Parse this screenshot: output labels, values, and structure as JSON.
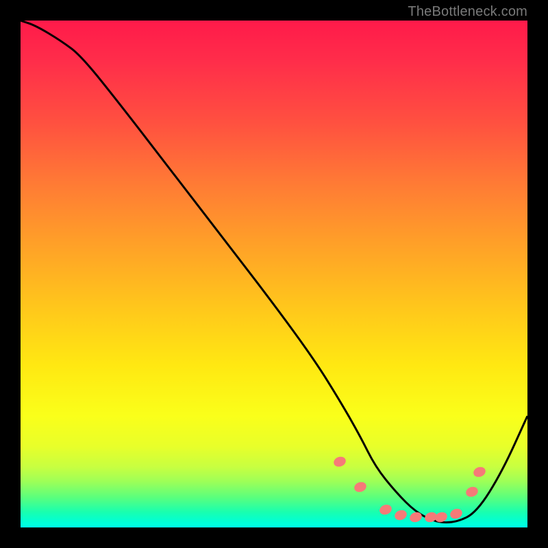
{
  "watermark": "TheBottleneck.com",
  "chart_data": {
    "type": "line",
    "title": "",
    "xlabel": "",
    "ylabel": "",
    "xlim": [
      0,
      100
    ],
    "ylim": [
      0,
      100
    ],
    "series": [
      {
        "name": "curve",
        "color": "#000000",
        "x": [
          0,
          3,
          8,
          12,
          20,
          30,
          40,
          50,
          58,
          63,
          67,
          70,
          74,
          78,
          82,
          86,
          90,
          95,
          100
        ],
        "y": [
          100,
          99,
          96,
          93,
          83,
          70,
          57,
          44,
          33,
          25,
          18,
          12,
          7,
          3,
          1,
          1,
          3,
          11,
          22
        ]
      }
    ],
    "markers": {
      "name": "highlight-dots",
      "color": "#f67a78",
      "points": [
        {
          "x": 63,
          "y": 13
        },
        {
          "x": 67,
          "y": 8
        },
        {
          "x": 72,
          "y": 3.5
        },
        {
          "x": 75,
          "y": 2.5
        },
        {
          "x": 78,
          "y": 2
        },
        {
          "x": 81,
          "y": 2
        },
        {
          "x": 83,
          "y": 2
        },
        {
          "x": 86,
          "y": 2.7
        },
        {
          "x": 89,
          "y": 7
        },
        {
          "x": 90.5,
          "y": 11
        }
      ]
    }
  }
}
